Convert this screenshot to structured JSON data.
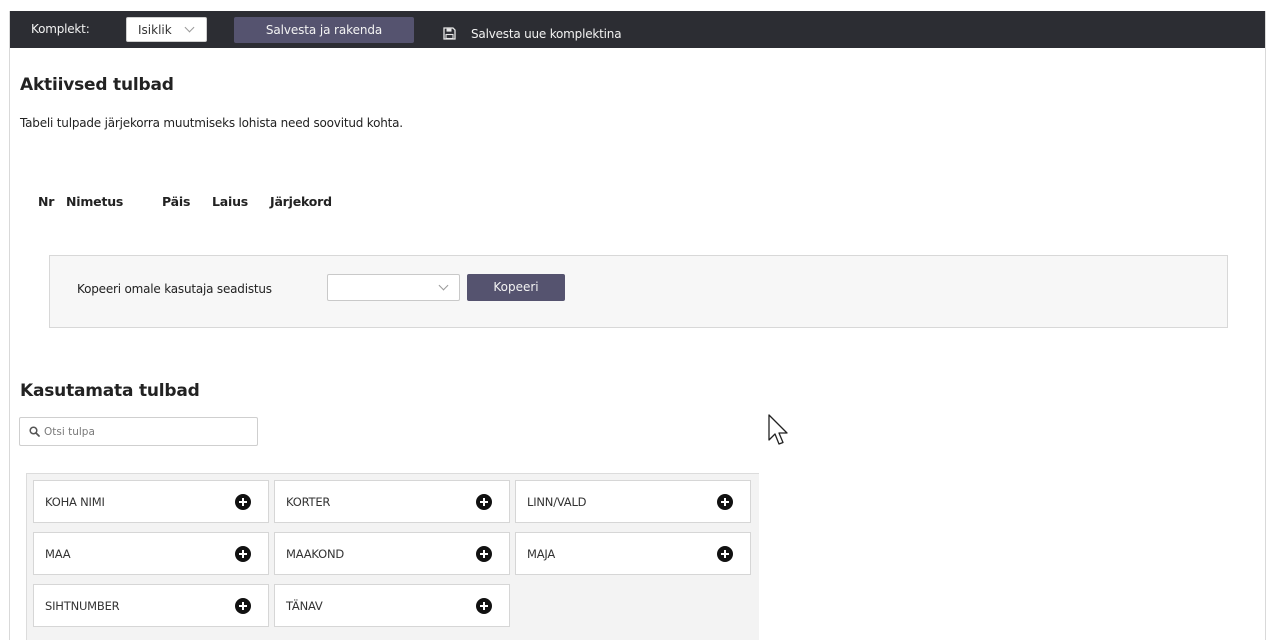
{
  "toolbar": {
    "set_label": "Komplekt:",
    "set_value": "Isiklik",
    "save_apply_label": "Salvesta ja rakenda",
    "save_new_label": "Salvesta uue komplektina",
    "icons": {
      "select_arrow": "chevron-down-icon",
      "save": "floppy-disk-icon"
    }
  },
  "active": {
    "title": "Aktiivsed tulbad",
    "description": "Tabeli tulpade järjekorra muutmiseks lohista need soovitud kohta.",
    "columns": [
      "Nr",
      "Nimetus",
      "Päis",
      "Laius",
      "Järjekord"
    ]
  },
  "copy": {
    "label": "Kopeeri omale kasutaja seadistus",
    "select_value": "",
    "button_label": "Kopeeri"
  },
  "unused": {
    "title": "Kasutamata tulbad",
    "search_placeholder": "Otsi tulpa",
    "search_value": "",
    "items": [
      "KOHA NIMI",
      "KORTER",
      "LINN/VALD",
      "MAA",
      "MAAKOND",
      "MAJA",
      "SIHTNUMBER",
      "TÄNAV"
    ],
    "item_icon": "plus-circle-icon"
  },
  "colors": {
    "toolbar_bg": "#2c2d33",
    "button_bg": "#55536f",
    "panel_bg": "#f7f7f7",
    "grid_bg": "#f3f3f3"
  }
}
